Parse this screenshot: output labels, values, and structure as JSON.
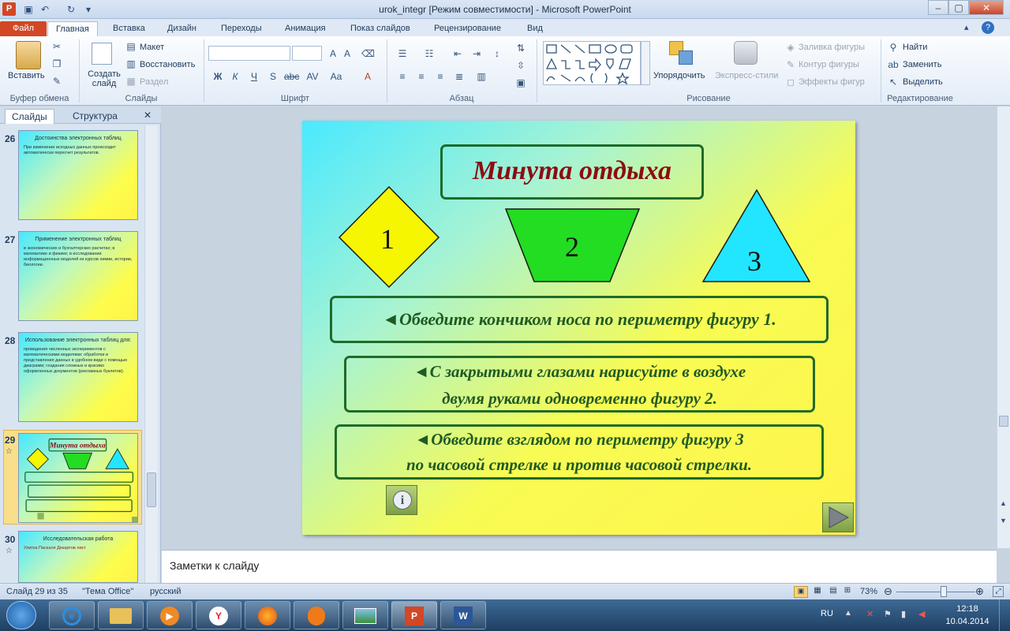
{
  "window": {
    "title": "urok_integr [Режим совместимости] - Microsoft PowerPoint",
    "app_icon": "P"
  },
  "tabs": [
    "Файл",
    "Главная",
    "Вставка",
    "Дизайн",
    "Переходы",
    "Анимация",
    "Показ слайдов",
    "Рецензирование",
    "Вид"
  ],
  "ribbon": {
    "clipboard": {
      "paste": "Вставить",
      "label": "Буфер обмена"
    },
    "slides": {
      "new_slide": "Создать слайд",
      "layout": "Макет",
      "reset": "Восстановить",
      "section": "Раздел",
      "label": "Слайды"
    },
    "font": {
      "label": "Шрифт"
    },
    "paragraph": {
      "label": "Абзац"
    },
    "drawing": {
      "arrange": "Упорядочить",
      "quick_styles": "Экспресс-стили",
      "fill": "Заливка фигуры",
      "outline": "Контур фигуры",
      "effects": "Эффекты фигур",
      "label": "Рисование"
    },
    "editing": {
      "find": "Найти",
      "replace": "Заменить",
      "select": "Выделить",
      "label": "Редактирование"
    }
  },
  "left_pane": {
    "tab_slides": "Слайды",
    "tab_outline": "Структура",
    "close": "✕",
    "thumbnails": [
      {
        "num": "26",
        "title": "Достоинства электронных таблиц",
        "body": "При изменении исходных данных происходит автоматически пересчет результатов."
      },
      {
        "num": "27",
        "title": "Применение электронных таблиц",
        "body": "в экономических и бухгалтерских расчетах; в математике и физике; в исследовании информационных моделей из курсов химии, истории, биологии."
      },
      {
        "num": "28",
        "title": "Использование электронных таблиц для:",
        "body": "проведения численных экспериментов с математическими моделями; обработки и представления данных в удобном виде с помощью диаграмм; создания сложных и красиво оформленных документов (рекламных буклетов)."
      },
      {
        "num": "29",
        "title": "Минута отдыха",
        "body": ""
      },
      {
        "num": "30",
        "title": "Исследовательская работа",
        "body": "Улитка Паскаля   Декартов лист"
      }
    ]
  },
  "slide": {
    "title": "Минута отдыха",
    "shape1": "1",
    "shape2": "2",
    "shape3": "3",
    "line1": "Обведите кончиком носа по периметру фигуру 1.",
    "line2a": "С закрытыми глазами нарисуйте в воздухе",
    "line2b": "двумя руками одновременно фигуру 2.",
    "line3a": "Обведите взглядом по периметру фигуру 3",
    "line3b": "по часовой стрелке и против часовой стрелки.",
    "arrow": "◄",
    "info_button": "i"
  },
  "notes": {
    "placeholder": "Заметки к слайду"
  },
  "status": {
    "slide": "Слайд 29 из 35",
    "theme": "\"Тема Office\"",
    "lang": "русский",
    "zoom": "73%",
    "zoom_fraction": 0.6
  },
  "taskbar": {
    "lang": "RU",
    "time": "12:18",
    "date": "10.04.2014"
  }
}
